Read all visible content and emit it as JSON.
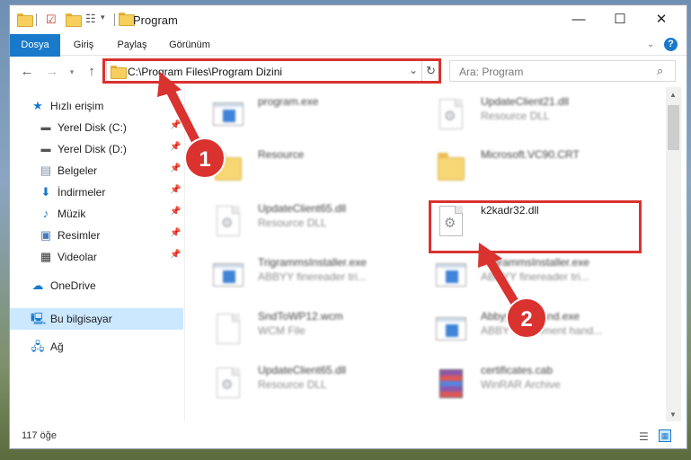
{
  "window": {
    "title": "Program",
    "controls": {
      "minimize": "—",
      "maximize": "☐",
      "close": "✕"
    }
  },
  "ribbon": {
    "tabs": [
      "Dosya",
      "Giriş",
      "Paylaş",
      "Görünüm"
    ],
    "help": "?"
  },
  "address": {
    "path": "C:\\Program Files\\Program Dizini",
    "search_placeholder": "Ara: Program"
  },
  "sidebar": {
    "items": [
      {
        "label": "Hızlı erişim",
        "icon": "star-icon"
      },
      {
        "label": "Yerel Disk (C:)",
        "icon": "drive-icon"
      },
      {
        "label": "Yerel Disk (D:)",
        "icon": "drive-icon"
      },
      {
        "label": "Belgeler",
        "icon": "documents-icon"
      },
      {
        "label": "İndirmeler",
        "icon": "download-icon"
      },
      {
        "label": "Müzik",
        "icon": "music-icon"
      },
      {
        "label": "Resimler",
        "icon": "pictures-icon"
      },
      {
        "label": "Videolar",
        "icon": "video-icon"
      },
      {
        "label": "OneDrive",
        "icon": "cloud-icon"
      },
      {
        "label": "Bu bilgisayar",
        "icon": "computer-icon"
      },
      {
        "label": "Ağ",
        "icon": "network-icon"
      }
    ]
  },
  "files": [
    {
      "name": "program.exe",
      "type": "",
      "icon": "installer-icon"
    },
    {
      "name": "UpdateClient21.dll",
      "type": "Resource DLL",
      "icon": "dll-icon"
    },
    {
      "name": "Resource",
      "type": "",
      "icon": "folder-icon"
    },
    {
      "name": "Microsoft.VC90.CRT",
      "type": "",
      "icon": "folder-icon"
    },
    {
      "name": "UpdateClient65.dll",
      "type": "Resource DLL",
      "icon": "dll-icon"
    },
    {
      "name": "k2kadr32.dll",
      "type": "",
      "icon": "dll-icon"
    },
    {
      "name": "TrigrammsInstaller.exe",
      "type": "ABBYY finereader tri...",
      "icon": "app-icon"
    },
    {
      "name": "TrigrammsInstaller.exe",
      "type": "ABBYY finereader tri...",
      "icon": "app-icon"
    },
    {
      "name": "SndToWP12.wcm",
      "type": "WCM File",
      "icon": "file-icon"
    },
    {
      "name": "AbbyyCmnHand.exe",
      "type": "ABBYY Comment hand...",
      "icon": "app-icon"
    },
    {
      "name": "UpdateClient65.dll",
      "type": "Resource DLL",
      "icon": "dll-icon"
    },
    {
      "name": "certificates.cab",
      "type": "WinRAR Archive",
      "icon": "archive-icon"
    }
  ],
  "status": {
    "item_count": "117 öğe"
  },
  "annotations": {
    "step1": "1",
    "step2": "2",
    "color": "#d9322f"
  }
}
